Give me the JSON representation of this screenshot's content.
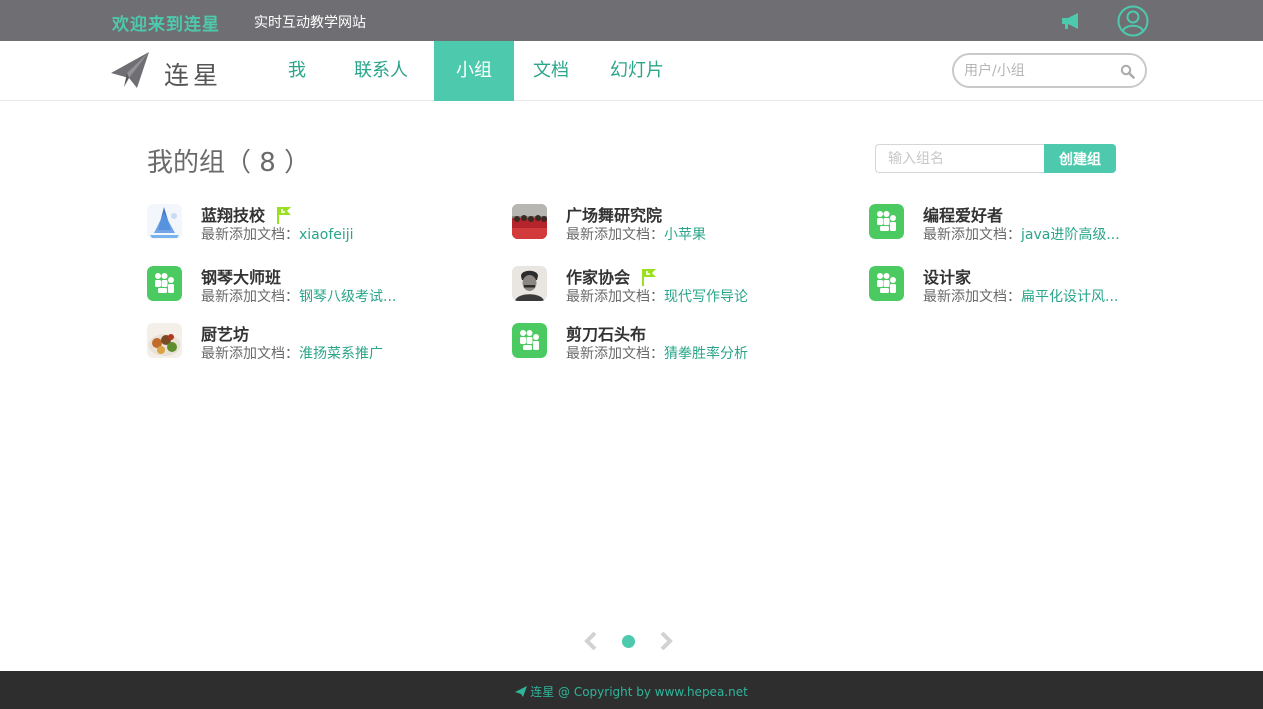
{
  "topbar": {
    "welcome": "欢迎来到连星",
    "tagline": "实时互动教学网站",
    "icons": [
      "megaphone-icon",
      "user-icon"
    ]
  },
  "navbar": {
    "logo_text": "连星",
    "items": [
      {
        "label": "我"
      },
      {
        "label": "联系人"
      },
      {
        "label": "小组",
        "active": true
      },
      {
        "label": "文档"
      },
      {
        "label": "幻灯片"
      }
    ],
    "search_placeholder": "用户/小组"
  },
  "main": {
    "title": "我的组（ 8 ）",
    "create_placeholder": "输入组名",
    "create_button": "创建组",
    "doc_label": "最新添加文档：",
    "groups": [
      {
        "name": "蓝翔技校",
        "flag": true,
        "latest_doc": "xiaofeiji",
        "avatar": "blue-tower"
      },
      {
        "name": "广场舞研究院",
        "flag": false,
        "latest_doc": "小苹果",
        "avatar": "red-crowd"
      },
      {
        "name": "编程爱好者",
        "flag": false,
        "latest_doc": "java进阶高级...",
        "avatar": "green-people"
      },
      {
        "name": "钢琴大师班",
        "flag": false,
        "latest_doc": "钢琴八级考试...",
        "avatar": "green-people"
      },
      {
        "name": "作家协会",
        "flag": true,
        "latest_doc": "现代写作导论",
        "avatar": "portrait"
      },
      {
        "name": "设计家",
        "flag": false,
        "latest_doc": "扁平化设计风...",
        "avatar": "green-people"
      },
      {
        "name": "厨艺坊",
        "flag": false,
        "latest_doc": "淮扬菜系推广",
        "avatar": "food"
      },
      {
        "name": "剪刀石头布",
        "flag": false,
        "latest_doc": "猜拳胜率分析",
        "avatar": "green-people"
      }
    ]
  },
  "pager": {
    "current_page": 1,
    "total_pages": 1
  },
  "footer": {
    "text": "连星 @ Copyright by www.hepea.net"
  },
  "colors": {
    "accent": "#4dc9ad",
    "link": "#2aa58a",
    "topbar": "#6f6e72",
    "footer": "#2e2e2e",
    "group_green": "#4cca62",
    "flag": "#9be020"
  }
}
